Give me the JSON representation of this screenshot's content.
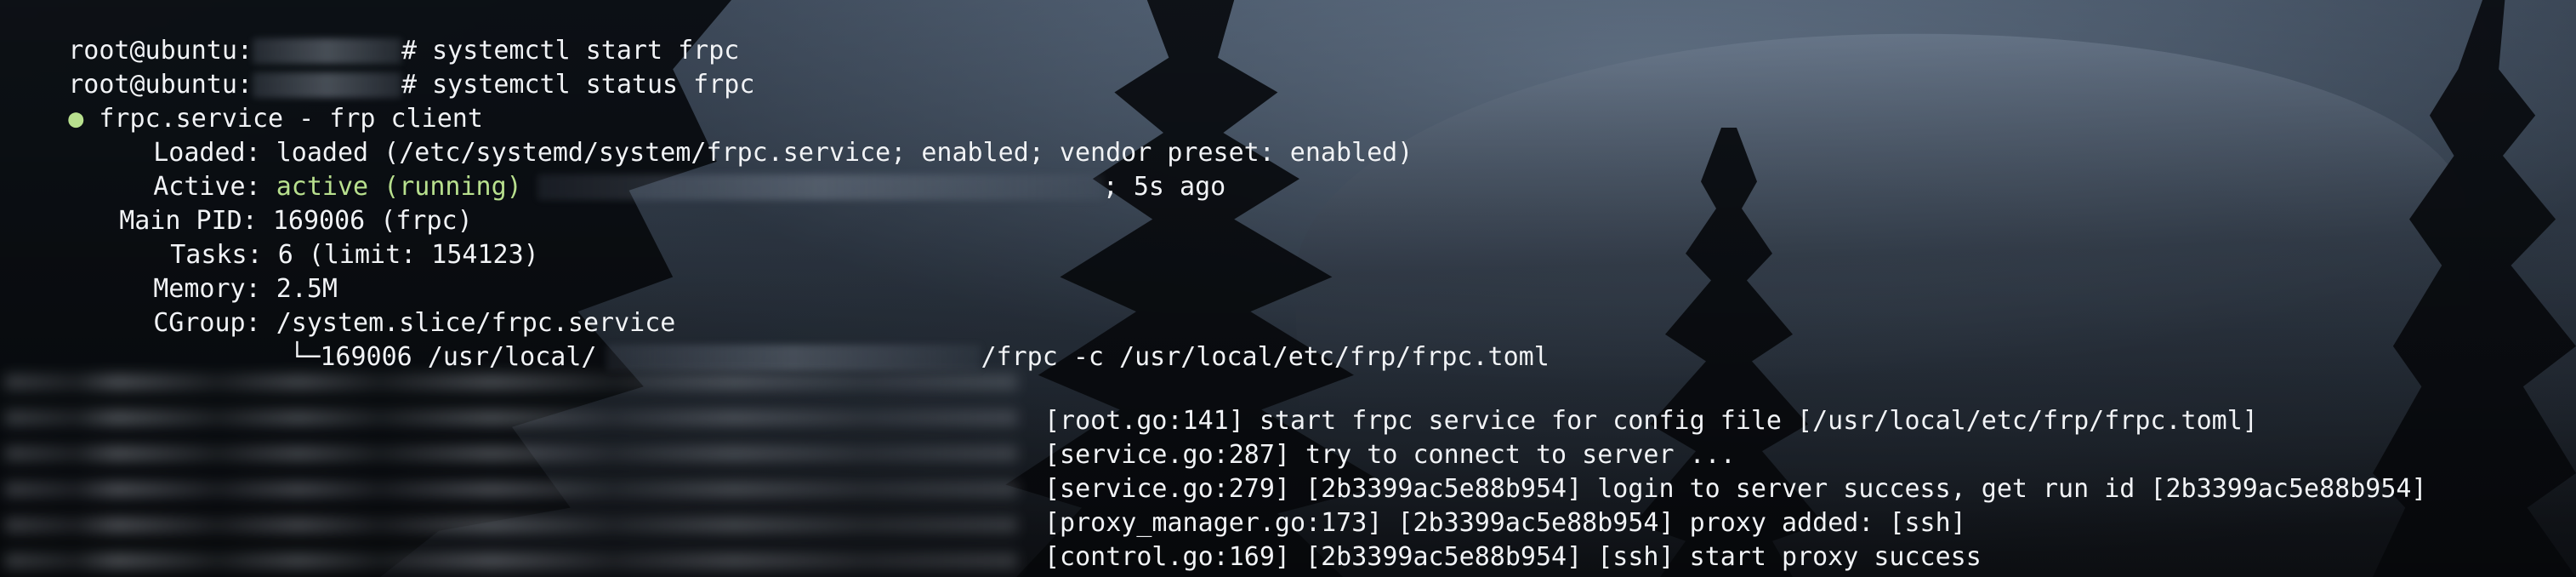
{
  "terminal": {
    "lines": {
      "prompt_1": {
        "user_host": "root@ubuntu:",
        "command": "# systemctl start frpc"
      },
      "prompt_2": {
        "user_host": "root@ubuntu:",
        "command": "# systemctl status frpc"
      },
      "service_header": {
        "dot": "●",
        "text": "frpc.service - frp client"
      },
      "loaded": {
        "label": "Loaded:",
        "value": "loaded (/etc/systemd/system/frpc.service; enabled; vendor preset: enabled)"
      },
      "active": {
        "label": "Active:",
        "state": "active (running)",
        "tail": "; 5s ago"
      },
      "main_pid": {
        "label": "Main PID:",
        "value": "169006 (frpc)"
      },
      "tasks": {
        "label": "Tasks:",
        "value": "6 (limit: 154123)"
      },
      "memory": {
        "label": "Memory:",
        "value": "2.5M"
      },
      "cgroup": {
        "label": "CGroup:",
        "value": "/system.slice/frpc.service"
      },
      "process": {
        "prefix": "└─169006 /usr/local/",
        "suffix": "/frpc -c /usr/local/etc/frp/frpc.toml"
      },
      "logs": [
        "[root.go:141] start frpc service for config file [/usr/local/etc/frp/frpc.toml]",
        "[service.go:287] try to connect to server ...",
        "[service.go:279] [2b3399ac5e88b954] login to server success, get run id [2b3399ac5e88b954]",
        "[proxy_manager.go:173] [2b3399ac5e88b954] proxy added: [ssh]",
        "[control.go:169] [2b3399ac5e88b954] [ssh] start proxy success"
      ]
    }
  },
  "colors": {
    "terminal_text": "#f1f3f6",
    "active_green": "#b8e08e",
    "background": "#1f252f"
  }
}
